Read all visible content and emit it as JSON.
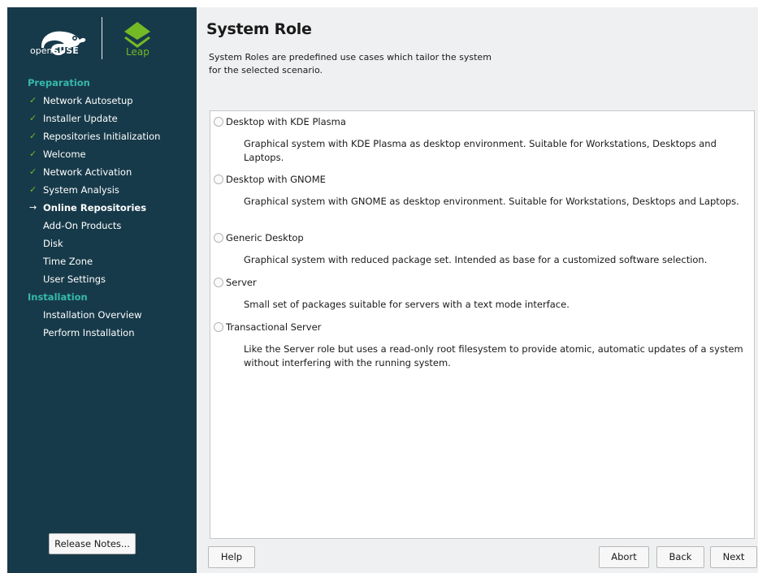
{
  "sidebar": {
    "brand": {
      "suse_prefix": "open",
      "suse_name": "SUSE",
      "leap_name": "Leap"
    },
    "sections": [
      {
        "title": "Preparation",
        "items": [
          {
            "label": "Network Autosetup",
            "state": "done",
            "mark": "✓"
          },
          {
            "label": "Installer Update",
            "state": "done",
            "mark": "✓"
          },
          {
            "label": "Repositories Initialization",
            "state": "done",
            "mark": "✓"
          },
          {
            "label": "Welcome",
            "state": "done",
            "mark": "✓"
          },
          {
            "label": "Network Activation",
            "state": "done",
            "mark": "✓"
          },
          {
            "label": "System Analysis",
            "state": "done",
            "mark": "✓"
          },
          {
            "label": "Online Repositories",
            "state": "current",
            "mark": "→"
          },
          {
            "label": "Add-On Products",
            "state": "pending",
            "mark": ""
          },
          {
            "label": "Disk",
            "state": "pending",
            "mark": ""
          },
          {
            "label": "Time Zone",
            "state": "pending",
            "mark": ""
          },
          {
            "label": "User Settings",
            "state": "pending",
            "mark": ""
          }
        ]
      },
      {
        "title": "Installation",
        "items": [
          {
            "label": "Installation Overview",
            "state": "pending",
            "mark": ""
          },
          {
            "label": "Perform Installation",
            "state": "pending",
            "mark": ""
          }
        ]
      }
    ],
    "release_notes_label": "Release Notes..."
  },
  "main": {
    "title": "System Role",
    "description": "System Roles are predefined use cases which tailor the system for the selected scenario.",
    "roles": [
      {
        "label": "Desktop with KDE Plasma",
        "description": "Graphical system with KDE Plasma as desktop environment. Suitable for Workstations, Desktops and Laptops.",
        "selected": false
      },
      {
        "label": "Desktop with GNOME",
        "description": "Graphical system with GNOME as desktop environment. Suitable for Workstations, Desktops and Laptops.",
        "selected": false
      },
      {
        "label": "Generic Desktop",
        "description": "Graphical system with reduced package set. Intended as base for a customized software selection.",
        "selected": false
      },
      {
        "label": "Server",
        "description": "Small set of packages suitable for servers with a text mode interface.",
        "selected": false
      },
      {
        "label": "Transactional Server",
        "description": "Like the Server role but uses a read-only root filesystem to provide atomic, automatic updates of a system without interfering with the running system.",
        "selected": false
      }
    ]
  },
  "buttons": {
    "help": "Help",
    "abort": "Abort",
    "back": "Back",
    "next": "Next"
  },
  "colors": {
    "sidebar_bg": "#173a4a",
    "section_title": "#35b9ab",
    "check": "#73ba25",
    "leap": "#73ba25"
  }
}
